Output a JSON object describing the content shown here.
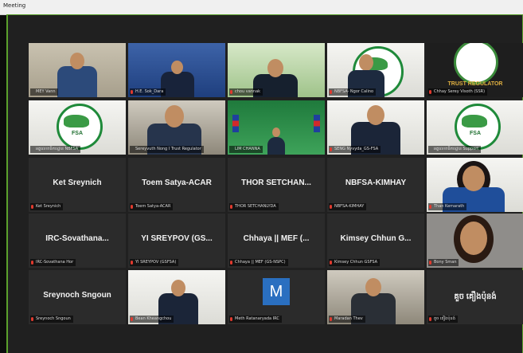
{
  "window": {
    "title": "Meeting"
  },
  "colors": {
    "active_border": "#8dc63f",
    "muted_mic": "#e03a2e",
    "frame_green": "#5aa02c"
  },
  "tiles": [
    {
      "label": "MEY Vann",
      "video": "person-office",
      "muted": false
    },
    {
      "label": "H.E. Sok_Dara",
      "video": "person-blue-backdrop",
      "muted": true
    },
    {
      "label": "chou vannak",
      "video": "person-green-backdrop",
      "muted": true,
      "active": true
    },
    {
      "label": "NBFSA- Ngor Calino",
      "video": "person-fsa-backdrop",
      "muted": true
    },
    {
      "label": "Chhay Serey Visoth (SSR)",
      "video": "trust-regulator-logo",
      "muted": true,
      "logo_text": "TRUST REGULATOR"
    },
    {
      "label": "អគ្គលេខាធិការដ្ឋាន NBFSA",
      "video": "fsa-logo",
      "muted": false,
      "logo_text": "FSA"
    },
    {
      "label": "Sereyvuth Nong I Trust Regulator",
      "video": "person-portrait",
      "muted": false
    },
    {
      "label": "LIM CHANNA",
      "video": "person-green-hall",
      "muted": false
    },
    {
      "label": "SENG Nyvyda_GS-FSA",
      "video": "person-portrait-white",
      "muted": true
    },
    {
      "label": "អគ្គលេខាធិការដ្ឋាន Support",
      "video": "fsa-logo",
      "muted": false,
      "logo_text": "FSA"
    },
    {
      "label": "Ket Sreynich",
      "display": "Ket Sreynich",
      "muted": true
    },
    {
      "label": "Toem Satya-ACAR",
      "display": "Toem Satya-ACAR",
      "muted": true
    },
    {
      "label": "THOR SETCHANLYDA",
      "display": "THOR  SETCHAN...",
      "muted": true
    },
    {
      "label": "NBFSA-KIMHAY",
      "display": "NBFSA-KIMHAY",
      "muted": true
    },
    {
      "label": "Than Kemarath",
      "video": "person-woman",
      "muted": true
    },
    {
      "label": "IRC-Sovathana Hor",
      "display": "IRC-Sovathana...",
      "muted": true
    },
    {
      "label": "YI SREYPOV (GSFSA)",
      "display": "YI SREYPOV (GS...",
      "muted": true
    },
    {
      "label": "Chhaya || MEF (GS-NSPC)",
      "display": "Chhaya || MEF (...",
      "muted": true
    },
    {
      "label": "Kimsey Chhun GSFSA",
      "display": "Kimsey Chhun G...",
      "muted": true
    },
    {
      "label": "Bony Sman",
      "video": "person-woman-2",
      "muted": true
    },
    {
      "label": "Sreynoch Sngoun",
      "display": "Sreynoch Sngoun",
      "muted": true
    },
    {
      "label": "Bean Kheangchou",
      "video": "person-portrait-small",
      "muted": true
    },
    {
      "label": "Meth Ratanaryada IRC",
      "avatar": "M",
      "muted": true
    },
    {
      "label": "Maradan Thev",
      "video": "person-office-2",
      "muted": true
    },
    {
      "label": "គួច គឿងប៉ុនង់",
      "display": "គួច គឿងប៉ុនង់",
      "muted": true
    }
  ]
}
